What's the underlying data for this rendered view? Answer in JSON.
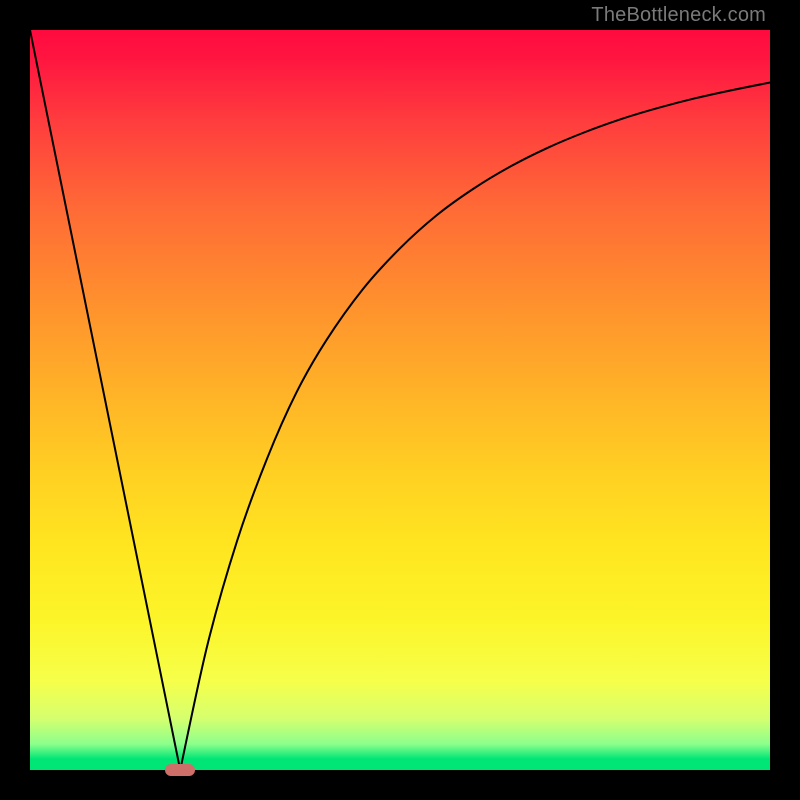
{
  "attribution": "TheBottleneck.com",
  "colors": {
    "gradient_top": "#ff0a3f",
    "gradient_bottom": "#00e676",
    "curve": "#000000",
    "marker": "#cf6f6a",
    "frame_bg": "#000000"
  },
  "chart_data": {
    "type": "line",
    "title": "",
    "xlabel": "",
    "ylabel": "",
    "xlim": [
      0,
      100
    ],
    "ylim": [
      0,
      100
    ],
    "series": [
      {
        "name": "left-branch",
        "x": [
          0,
          20.3
        ],
        "y": [
          100,
          0
        ]
      },
      {
        "name": "right-branch",
        "x": [
          20.3,
          24,
          28,
          32,
          36,
          40,
          45,
          50,
          55,
          60,
          65,
          70,
          75,
          80,
          85,
          90,
          95,
          100
        ],
        "y": [
          0,
          17,
          31,
          42,
          51,
          58,
          65,
          70.5,
          75,
          78.6,
          81.6,
          84.1,
          86.2,
          88,
          89.5,
          90.8,
          91.9,
          92.9
        ]
      }
    ],
    "annotations": [
      {
        "name": "min-marker",
        "x": 20.3,
        "y": 0
      }
    ],
    "grid": false,
    "legend": false
  }
}
